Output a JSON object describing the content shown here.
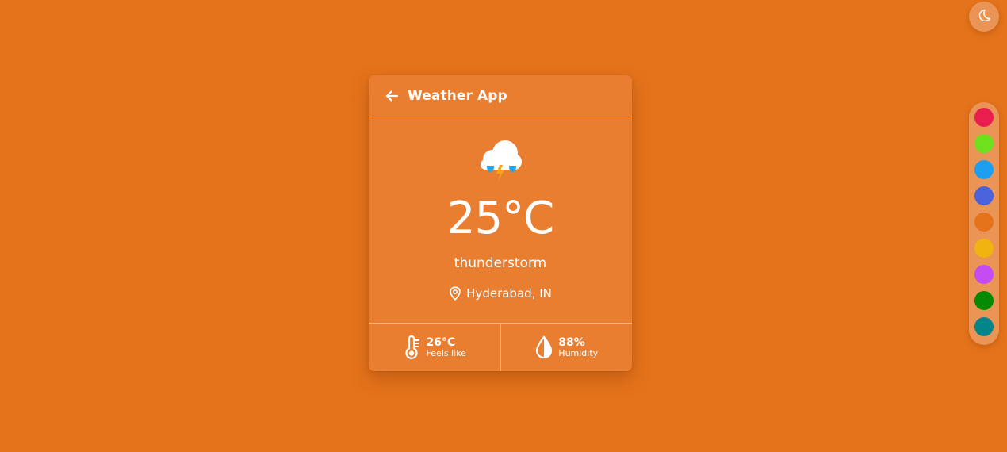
{
  "app": {
    "title": "Weather App"
  },
  "weather": {
    "temperature": "25°C",
    "condition": "thunderstorm",
    "location": "Hyderabad, IN",
    "icon": "thunderstorm-cloud-icon"
  },
  "stats": {
    "feels_like": {
      "value": "26°C",
      "label": "Feels like",
      "icon": "thermometer-icon"
    },
    "humidity": {
      "value": "88%",
      "label": "Humidity",
      "icon": "water-drop-icon"
    }
  },
  "controls": {
    "theme_toggle_icon": "moon-icon",
    "palette": [
      {
        "name": "crimson",
        "color": "#e91e4f"
      },
      {
        "name": "lime",
        "color": "#6fe01c"
      },
      {
        "name": "sky-blue",
        "color": "#1c9ff0"
      },
      {
        "name": "royal-blue",
        "color": "#4a63dc"
      },
      {
        "name": "orange",
        "color": "#e5731b"
      },
      {
        "name": "amber",
        "color": "#f0b30f"
      },
      {
        "name": "purple",
        "color": "#c44cf2"
      },
      {
        "name": "green",
        "color": "#048a04"
      },
      {
        "name": "teal",
        "color": "#04858a"
      }
    ]
  },
  "colors": {
    "background": "#e5731b",
    "card": "#e97d30",
    "controls": "#ea9456",
    "text": "#ffffff"
  }
}
